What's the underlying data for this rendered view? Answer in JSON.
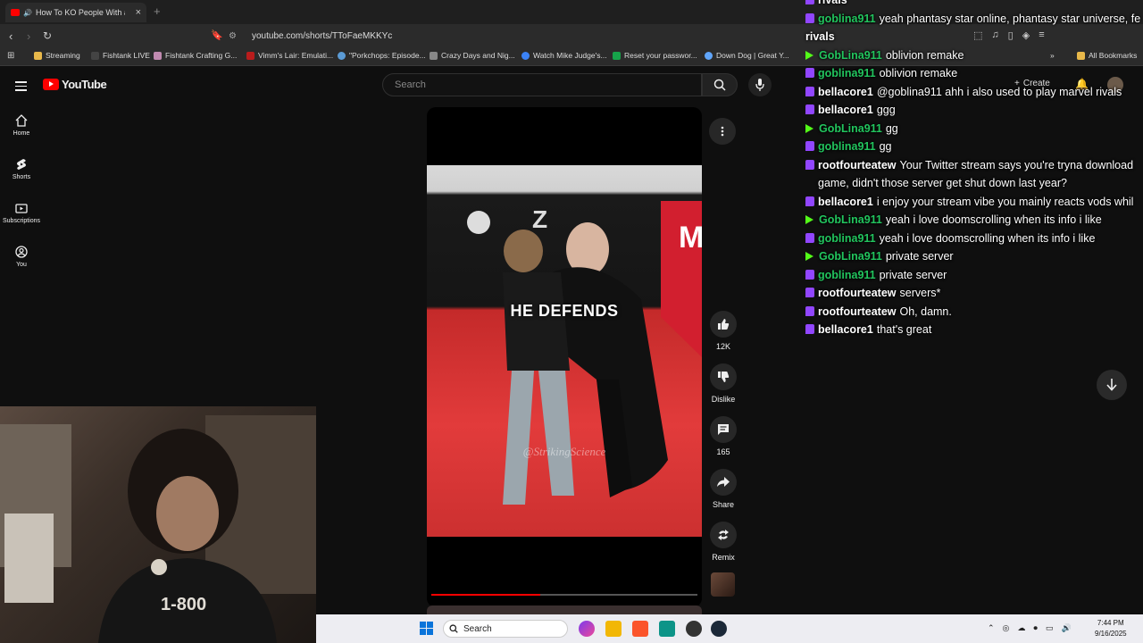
{
  "browser": {
    "tab_title": "How To KO People With a Cl...",
    "url": "youtube.com/shorts/TToFaeMKKYc",
    "bookmarks": [
      "Streaming",
      "Fishtank LIVE",
      "Fishtank Crafting G...",
      "Vimm's Lair: Emulati...",
      "\"Porkchops: Episode...",
      "Crazy Days and Nig...",
      "Watch Mike Judge's...",
      "Reset your passwor...",
      "Down Dog | Great Y..."
    ],
    "all_bookmarks": "All Bookmarks",
    "colors": {
      "chrome": "#2b2b2b",
      "tabbar": "#1f1f1f"
    }
  },
  "youtube": {
    "logo_text": "YouTube",
    "search_placeholder": "Search",
    "create_label": "Create",
    "sidebar": [
      {
        "label": "Home",
        "icon": "home-icon"
      },
      {
        "label": "Shorts",
        "icon": "shorts-icon"
      },
      {
        "label": "Subscriptions",
        "icon": "subscriptions-icon"
      },
      {
        "label": "You",
        "icon": "you-icon"
      }
    ],
    "short": {
      "caption": "HE DEFENDS",
      "watermark": "@StrikingScience",
      "progress": 0.41
    },
    "actions": {
      "likes": "12K",
      "dislike": "Dislike",
      "comments": "165",
      "share": "Share",
      "remix": "Remix"
    },
    "brand_color": "#ff0000"
  },
  "chat": {
    "messages": [
      {
        "user": "rivals",
        "text": "",
        "platform": "twitch"
      },
      {
        "user": "goblina911",
        "text": "yeah phantasy star online, phantasy star universe, fe",
        "platform": "twitch",
        "color": "#22c55e"
      },
      {
        "user": "rivals",
        "text": "",
        "platform": "none",
        "color": "#ffffff"
      },
      {
        "user": "GobLina911",
        "text": "oblivion remake",
        "platform": "kick",
        "color": "#22c55e"
      },
      {
        "user": "goblina911",
        "text": "oblivion remake",
        "platform": "twitch",
        "color": "#22c55e"
      },
      {
        "user": "bellacore1",
        "text": "@goblina911 ahh i also used to play marvel rivals",
        "platform": "twitch",
        "color": "#ffffff"
      },
      {
        "user": "bellacore1",
        "text": "ggg",
        "platform": "twitch",
        "color": "#ffffff"
      },
      {
        "user": "GobLina911",
        "text": "gg",
        "platform": "kick",
        "color": "#22c55e"
      },
      {
        "user": "goblina911",
        "text": "gg",
        "platform": "twitch",
        "color": "#22c55e"
      },
      {
        "user": "rootfourteatew",
        "text": "Your Twitter stream says you're tryna download",
        "platform": "twitch",
        "color": "#ffffff"
      },
      {
        "user": "",
        "text": "game, didn't those server get shut down last year?",
        "platform": "none",
        "color": "#ffffff"
      },
      {
        "user": "bellacore1",
        "text": "i enjoy your stream vibe you mainly reacts vods whil",
        "platform": "twitch",
        "color": "#ffffff"
      },
      {
        "user": "GobLina911",
        "text": "yeah i love doomscrolling when its info i like",
        "platform": "kick",
        "color": "#22c55e"
      },
      {
        "user": "goblina911",
        "text": "yeah i love doomscrolling when its info i like",
        "platform": "twitch",
        "color": "#22c55e"
      },
      {
        "user": "GobLina911",
        "text": "private server",
        "platform": "kick",
        "color": "#22c55e"
      },
      {
        "user": "goblina911",
        "text": "private server",
        "platform": "twitch",
        "color": "#22c55e"
      },
      {
        "user": "rootfourteatew",
        "text": "servers*",
        "platform": "twitch",
        "color": "#ffffff"
      },
      {
        "user": "rootfourteatew",
        "text": "Oh, damn.",
        "platform": "twitch",
        "color": "#ffffff"
      },
      {
        "user": "bellacore1",
        "text": "that's great",
        "platform": "twitch",
        "color": "#ffffff"
      }
    ]
  },
  "taskbar": {
    "search_label": "Search",
    "time": "7:44 PM",
    "date": "9/16/2025"
  }
}
